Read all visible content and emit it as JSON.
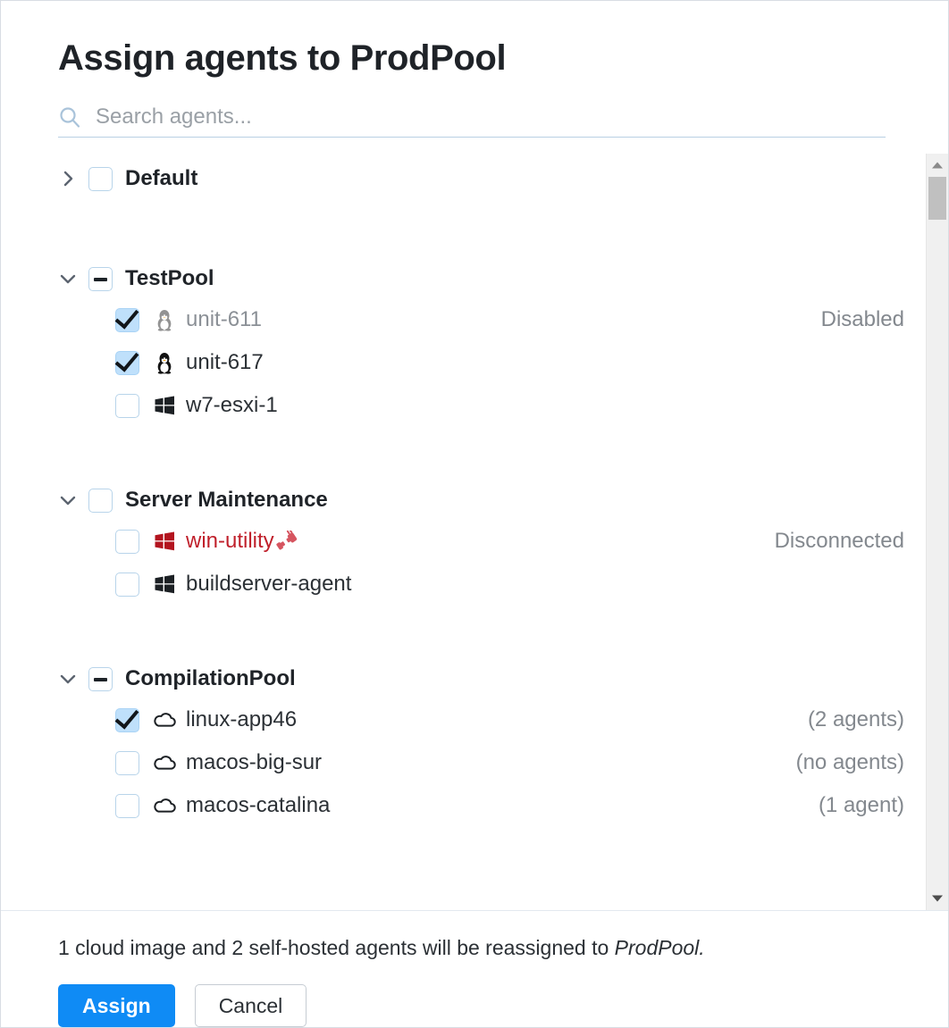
{
  "dialog": {
    "title": "Assign agents to ProdPool"
  },
  "search": {
    "placeholder": "Search agents...",
    "value": "",
    "icon": "search-icon"
  },
  "tree": {
    "groups": [
      {
        "label": "Default",
        "expanded": false,
        "chevron": "chevron-right-icon",
        "checkbox_state": "unchecked",
        "agents": []
      },
      {
        "label": "TestPool",
        "expanded": true,
        "chevron": "chevron-down-icon",
        "checkbox_state": "indeterminate",
        "agents": [
          {
            "name": "unit-611",
            "icon": "linux-penguin-icon",
            "checkbox_state": "checked",
            "status": "Disabled",
            "state": "dim"
          },
          {
            "name": "unit-617",
            "icon": "linux-penguin-icon",
            "checkbox_state": "checked",
            "status": "",
            "state": "normal"
          },
          {
            "name": "w7-esxi-1",
            "icon": "windows-icon",
            "checkbox_state": "unchecked",
            "status": "",
            "state": "normal"
          }
        ]
      },
      {
        "label": "Server Maintenance",
        "expanded": true,
        "chevron": "chevron-down-icon",
        "checkbox_state": "unchecked",
        "agents": [
          {
            "name": "win-utility",
            "icon": "windows-icon-red",
            "trailing_icon": "disconnected-plug-icon",
            "checkbox_state": "unchecked",
            "status": "Disconnected",
            "state": "error"
          },
          {
            "name": "buildserver-agent",
            "icon": "windows-icon",
            "checkbox_state": "unchecked",
            "status": "",
            "state": "normal"
          }
        ]
      },
      {
        "label": "CompilationPool",
        "expanded": true,
        "chevron": "chevron-down-icon",
        "checkbox_state": "indeterminate",
        "agents": [
          {
            "name": "linux-app46",
            "icon": "cloud-icon",
            "checkbox_state": "checked",
            "status": "(2 agents)",
            "state": "normal"
          },
          {
            "name": "macos-big-sur",
            "icon": "cloud-icon",
            "checkbox_state": "unchecked",
            "status": "(no agents)",
            "state": "normal"
          },
          {
            "name": "macos-catalina",
            "icon": "cloud-icon",
            "checkbox_state": "unchecked",
            "status": "(1 agent)",
            "state": "normal"
          }
        ]
      }
    ]
  },
  "scrollbar": {
    "up_icon": "scroll-up-arrow-icon",
    "down_icon": "scroll-down-arrow-icon"
  },
  "footer": {
    "note_prefix": "1 cloud image and 2 self-hosted agents will be reassigned to ",
    "note_target": "ProdPool.",
    "assign_label": "Assign",
    "cancel_label": "Cancel"
  },
  "colors": {
    "accent": "#0f8bf5",
    "error": "#c0202b",
    "checkbox_fill": "#bfe0fb",
    "muted_text": "#83888e"
  }
}
